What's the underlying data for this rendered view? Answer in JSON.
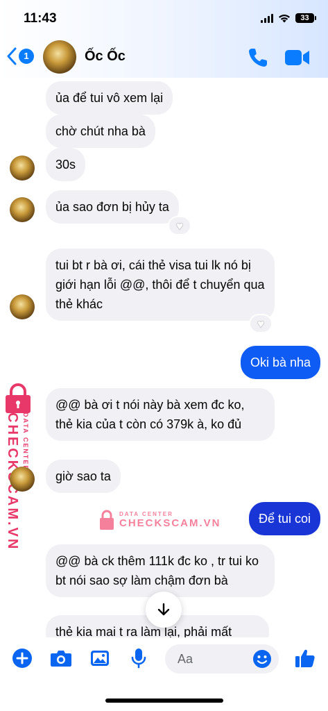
{
  "status_bar": {
    "time": "11:43",
    "battery": "33"
  },
  "header": {
    "back_count": "1",
    "contact_name": "Ốc Ốc"
  },
  "messages": [
    {
      "text": "ủa để tui vô xem lại"
    },
    {
      "text": "chờ chút nha bà"
    },
    {
      "text": "30s"
    },
    {
      "text": "ủa sao đơn bị hủy ta",
      "reaction": "♥"
    },
    {
      "text": "tui bt r bà ơi, cái thẻ visa tui lk nó bị giới hạn lỗi @@, thôi để t chuyển qua thẻ khác",
      "reaction": "♥"
    },
    {
      "text": "Oki bà nha"
    },
    {
      "text": "@@ bà ơi t nói này bà xem đc ko, thẻ kia của t còn có 379k à, ko đủ"
    },
    {
      "text": "giờ sao ta"
    },
    {
      "text": "Để tui coi"
    },
    {
      "text": "@@ bà ck thêm 111k đc ko , tr tui ko bt nói sao sợ làm chậm đơn bà"
    },
    {
      "text": "thẻ kia mai t ra làm lại, phải mất"
    }
  ],
  "watermark": {
    "small": "DATA CENTER",
    "brand": "CHECKSCAM.VN"
  },
  "composer": {
    "placeholder": "Aa"
  },
  "colors": {
    "accent": "#0a7cff",
    "outgoing": "#0f5cf5",
    "outgoing_dark": "#1935d6",
    "incoming": "#f0f0f5",
    "watermark": "#e8386a"
  },
  "icons": [
    "back-chevron-icon",
    "phone-icon",
    "video-camera-icon",
    "add-circle-icon",
    "camera-icon",
    "gallery-icon",
    "microphone-icon",
    "emoji-icon",
    "thumbs-up-icon",
    "arrow-down-icon"
  ]
}
